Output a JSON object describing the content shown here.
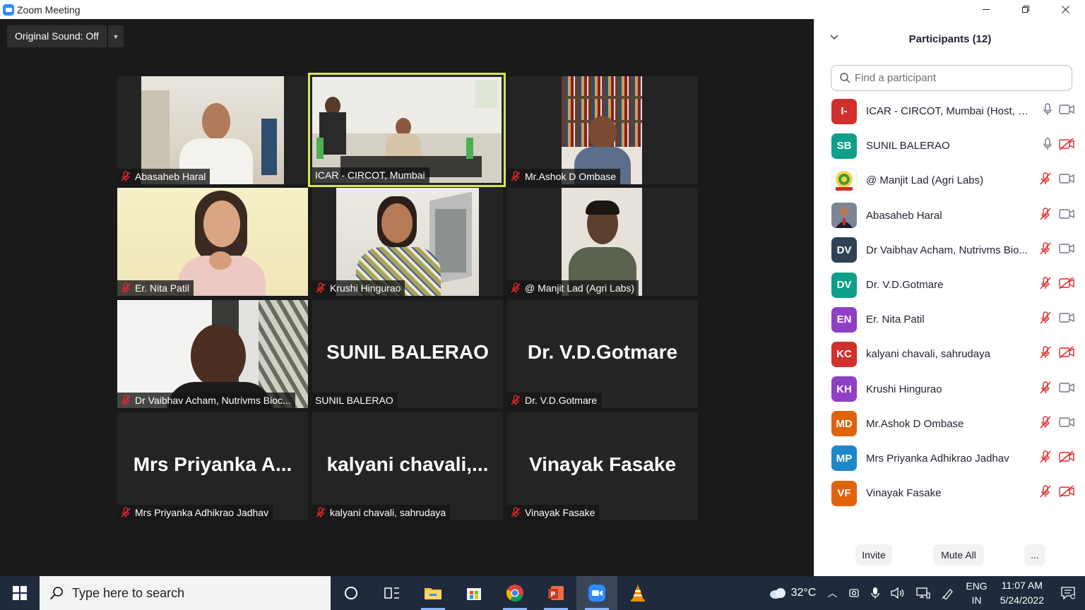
{
  "window": {
    "title": "Zoom Meeting"
  },
  "toolbar": {
    "original_sound_label": "Original Sound: Off"
  },
  "tiles": [
    {
      "name": "Abasaheb Haral",
      "muted": true
    },
    {
      "name": "ICAR - CIRCOT, Mumbai",
      "muted": false
    },
    {
      "name": "Mr.Ashok D Ombase",
      "muted": true
    },
    {
      "name": "Er. Nita Patil",
      "muted": true
    },
    {
      "name": "Krushi Hingurao",
      "muted": true
    },
    {
      "name": "@ Manjit Lad (Agri Labs)",
      "muted": true
    },
    {
      "name": "Dr Vaibhav Acham, Nutrivms Bioc...",
      "muted": true
    },
    {
      "name": "SUNIL BALERAO",
      "big_label": "SUNIL BALERAO",
      "muted": false
    },
    {
      "name": "Dr. V.D.Gotmare",
      "big_label": "Dr. V.D.Gotmare",
      "muted": true
    },
    {
      "name": "Mrs Priyanka Adhikrao Jadhav",
      "big_label": "Mrs  Priyanka  A...",
      "muted": true
    },
    {
      "name": "kalyani chavali, sahrudaya",
      "big_label": "kalyani  chavali,...",
      "muted": true
    },
    {
      "name": "Vinayak Fasake",
      "big_label": "Vinayak Fasake",
      "muted": true
    }
  ],
  "participants_panel": {
    "title": "Participants (12)",
    "search_placeholder": "Find a participant",
    "participants": [
      {
        "initials": "I-",
        "name": "ICAR - CIRCOT, Mumbai (Host, me)",
        "color": "#d0312d",
        "mic": "on",
        "video": "on"
      },
      {
        "initials": "SB",
        "name": "SUNIL BALERAO",
        "color": "#0e9f8a",
        "mic": "on",
        "video": "off"
      },
      {
        "initials": "",
        "name": "@ Manjit Lad (Agri Labs)",
        "color": "#ffffff",
        "mic": "off",
        "video": "on",
        "avatar": "logo"
      },
      {
        "initials": "",
        "name": "Abasaheb Haral",
        "color": "#556677",
        "mic": "off",
        "video": "on",
        "avatar": "photo"
      },
      {
        "initials": "DV",
        "name": "Dr Vaibhav Acham, Nutrivms Bio...",
        "color": "#2f4154",
        "mic": "off",
        "video": "on"
      },
      {
        "initials": "DV",
        "name": "Dr. V.D.Gotmare",
        "color": "#0e9f8a",
        "mic": "off",
        "video": "off"
      },
      {
        "initials": "EN",
        "name": "Er. Nita Patil",
        "color": "#8e3fc4",
        "mic": "off",
        "video": "on"
      },
      {
        "initials": "KC",
        "name": "kalyani chavali, sahrudaya",
        "color": "#d0312d",
        "mic": "off",
        "video": "off"
      },
      {
        "initials": "KH",
        "name": "Krushi Hingurao",
        "color": "#8e3fc4",
        "mic": "off",
        "video": "on"
      },
      {
        "initials": "MD",
        "name": "Mr.Ashok D Ombase",
        "color": "#e0640e",
        "mic": "off",
        "video": "on"
      },
      {
        "initials": "MP",
        "name": "Mrs Priyanka Adhikrao Jadhav",
        "color": "#1f86c8",
        "mic": "off",
        "video": "off"
      },
      {
        "initials": "VF",
        "name": "Vinayak Fasake",
        "color": "#e0640e",
        "mic": "off",
        "video": "off"
      }
    ],
    "invite_label": "Invite",
    "mute_all_label": "Mute All",
    "more_label": "..."
  },
  "taskbar": {
    "search_placeholder": "Type here to search",
    "weather": "32°C",
    "language_line1": "ENG",
    "language_line2": "IN",
    "time": "11:07 AM",
    "date": "5/24/2022"
  },
  "colors": {
    "active_speaker": "#d6e84a",
    "muted_red": "#e02828",
    "accent": "#2d8cff"
  }
}
